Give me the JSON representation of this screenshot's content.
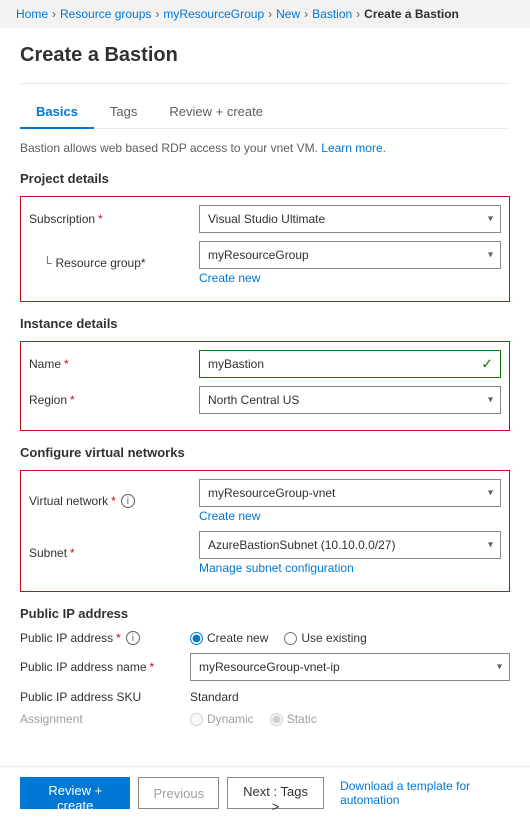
{
  "breadcrumb": {
    "items": [
      {
        "label": "Home",
        "link": true
      },
      {
        "label": "Resource groups",
        "link": true
      },
      {
        "label": "myResourceGroup",
        "link": true
      },
      {
        "label": "New",
        "link": true
      },
      {
        "label": "Bastion",
        "link": true
      },
      {
        "label": "Create a Bastion",
        "link": false,
        "current": true
      }
    ],
    "separator": ">"
  },
  "page": {
    "title": "Create a Bastion"
  },
  "tabs": [
    {
      "label": "Basics",
      "active": true
    },
    {
      "label": "Tags",
      "active": false
    },
    {
      "label": "Review + create",
      "active": false
    }
  ],
  "description": {
    "text": "Bastion allows web based RDP access to your vnet VM.",
    "link_text": "Learn more."
  },
  "sections": {
    "project_details": {
      "title": "Project details",
      "subscription": {
        "label": "Subscription",
        "required": true,
        "value": "Visual Studio Ultimate"
      },
      "resource_group": {
        "label": "Resource group",
        "required": true,
        "value": "myResourceGroup",
        "create_new": "Create new"
      }
    },
    "instance_details": {
      "title": "Instance details",
      "name": {
        "label": "Name",
        "required": true,
        "value": "myBastion"
      },
      "region": {
        "label": "Region",
        "required": true,
        "value": "North Central US"
      }
    },
    "virtual_networks": {
      "title": "Configure virtual networks",
      "virtual_network": {
        "label": "Virtual network",
        "required": true,
        "has_info": true,
        "value": "myResourceGroup-vnet",
        "create_new": "Create new"
      },
      "subnet": {
        "label": "Subnet",
        "required": true,
        "value": "AzureBastionSubnet (10.10.0.0/27)",
        "manage_link": "Manage subnet configuration"
      }
    },
    "public_ip": {
      "title": "Public IP address",
      "address": {
        "label": "Public IP address",
        "required": true,
        "has_info": true,
        "options": [
          "Create new",
          "Use existing"
        ],
        "selected": "Create new"
      },
      "name": {
        "label": "Public IP address name",
        "required": true,
        "value": "myResourceGroup-vnet-ip"
      },
      "sku": {
        "label": "Public IP address SKU",
        "value": "Standard"
      },
      "assignment": {
        "label": "Assignment",
        "options": [
          "Dynamic",
          "Static"
        ],
        "selected": "Static",
        "dynamic_disabled": true
      }
    }
  },
  "footer": {
    "review_create": "Review + create",
    "previous": "Previous",
    "next": "Next : Tags >",
    "download": "Download a template for automation"
  }
}
